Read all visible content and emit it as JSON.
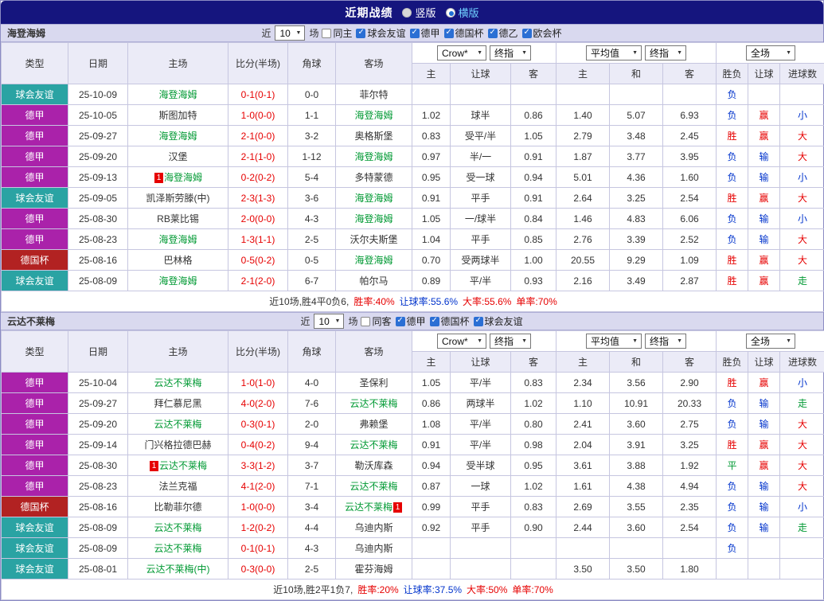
{
  "title_bar": {
    "title": "近期战绩",
    "options": [
      {
        "label": "竖版",
        "selected": false
      },
      {
        "label": "横版",
        "selected": true
      }
    ]
  },
  "table_headers": {
    "left": [
      "类型",
      "日期",
      "主场",
      "比分(半场)",
      "角球",
      "客场"
    ],
    "odds_cols": [
      "主",
      "让球",
      "客"
    ],
    "avg_cols": [
      "主",
      "和",
      "客"
    ],
    "result_cols": [
      "胜负",
      "让球",
      "进球数"
    ],
    "odds_selects": [
      "Crow*",
      "终指"
    ],
    "avg_selects": [
      "平均值",
      "终指"
    ],
    "scope_select": "全场"
  },
  "league_styles": {
    "球会友谊": {
      "bg": "#2aa3a3",
      "fg": "#ffffff"
    },
    "德甲": {
      "bg": "#aa22aa",
      "fg": "#ffffff"
    },
    "德国杯": {
      "bg": "#b22222",
      "fg": "#ffffff"
    }
  },
  "result_colors": {
    "胜": "#e60000",
    "平": "#009933",
    "负": "#0033cc",
    "赢": "#e60000",
    "输": "#0033cc",
    "大": "#e60000",
    "小": "#0033cc",
    "走": "#009933"
  },
  "sections": [
    {
      "team": "海登海姆",
      "filter": {
        "near_label": "近",
        "count": "10",
        "games_label": "场",
        "checkboxes": [
          {
            "label": "同主",
            "checked": false
          },
          {
            "label": "球会友谊",
            "checked": true
          },
          {
            "label": "德甲",
            "checked": true
          },
          {
            "label": "德国杯",
            "checked": true
          },
          {
            "label": "德乙",
            "checked": true
          },
          {
            "label": "欧会杯",
            "checked": true
          }
        ]
      },
      "rows": [
        {
          "lg": "球会友谊",
          "dt": "25-10-09",
          "hm": "海登海姆",
          "hmT": true,
          "aw": "菲尔特",
          "awT": false,
          "sc": "0-1",
          "hf": "(0-1)",
          "cn": "0-0",
          "od": [
            "",
            "",
            ""
          ],
          "av": [
            "",
            "",
            ""
          ],
          "rs": [
            "负",
            "",
            ""
          ]
        },
        {
          "lg": "德甲",
          "dt": "25-10-05",
          "hm": "斯图加特",
          "hmT": false,
          "aw": "海登海姆",
          "awT": true,
          "sc": "1-0",
          "hf": "(0-0)",
          "cn": "1-1",
          "od": [
            "1.02",
            "球半",
            "0.86"
          ],
          "av": [
            "1.40",
            "5.07",
            "6.93"
          ],
          "rs": [
            "负",
            "赢",
            "小"
          ]
        },
        {
          "lg": "德甲",
          "dt": "25-09-27",
          "hm": "海登海姆",
          "hmT": true,
          "aw": "奥格斯堡",
          "awT": false,
          "sc": "2-1",
          "hf": "(0-0)",
          "cn": "3-2",
          "od": [
            "0.83",
            "受平/半",
            "1.05"
          ],
          "av": [
            "2.79",
            "3.48",
            "2.45"
          ],
          "rs": [
            "胜",
            "赢",
            "大"
          ]
        },
        {
          "lg": "德甲",
          "dt": "25-09-20",
          "hm": "汉堡",
          "hmT": false,
          "aw": "海登海姆",
          "awT": true,
          "sc": "2-1",
          "hf": "(1-0)",
          "cn": "1-12",
          "od": [
            "0.97",
            "半/一",
            "0.91"
          ],
          "av": [
            "1.87",
            "3.77",
            "3.95"
          ],
          "rs": [
            "负",
            "输",
            "大"
          ]
        },
        {
          "lg": "德甲",
          "dt": "25-09-13",
          "hm": "海登海姆",
          "hmT": true,
          "hmB": "1",
          "hmBp": "L",
          "aw": "多特蒙德",
          "awT": false,
          "sc": "0-2",
          "hf": "(0-2)",
          "cn": "5-4",
          "od": [
            "0.95",
            "受一球",
            "0.94"
          ],
          "av": [
            "5.01",
            "4.36",
            "1.60"
          ],
          "rs": [
            "负",
            "输",
            "小"
          ]
        },
        {
          "lg": "球会友谊",
          "dt": "25-09-05",
          "hm": "凯泽斯劳滕(中)",
          "hmT": false,
          "aw": "海登海姆",
          "awT": true,
          "sc": "2-3",
          "hf": "(1-3)",
          "cn": "3-6",
          "od": [
            "0.91",
            "平手",
            "0.91"
          ],
          "av": [
            "2.64",
            "3.25",
            "2.54"
          ],
          "rs": [
            "胜",
            "赢",
            "大"
          ]
        },
        {
          "lg": "德甲",
          "dt": "25-08-30",
          "hm": "RB莱比锡",
          "hmT": false,
          "aw": "海登海姆",
          "awT": true,
          "sc": "2-0",
          "hf": "(0-0)",
          "cn": "4-3",
          "od": [
            "1.05",
            "一/球半",
            "0.84"
          ],
          "av": [
            "1.46",
            "4.83",
            "6.06"
          ],
          "rs": [
            "负",
            "输",
            "小"
          ]
        },
        {
          "lg": "德甲",
          "dt": "25-08-23",
          "hm": "海登海姆",
          "hmT": true,
          "aw": "沃尔夫斯堡",
          "awT": false,
          "sc": "1-3",
          "hf": "(1-1)",
          "cn": "2-5",
          "od": [
            "1.04",
            "平手",
            "0.85"
          ],
          "av": [
            "2.76",
            "3.39",
            "2.52"
          ],
          "rs": [
            "负",
            "输",
            "大"
          ]
        },
        {
          "lg": "德国杯",
          "dt": "25-08-16",
          "hm": "巴林格",
          "hmT": false,
          "aw": "海登海姆",
          "awT": true,
          "sc": "0-5",
          "hf": "(0-2)",
          "cn": "0-5",
          "od": [
            "0.70",
            "受两球半",
            "1.00"
          ],
          "av": [
            "20.55",
            "9.29",
            "1.09"
          ],
          "rs": [
            "胜",
            "赢",
            "大"
          ]
        },
        {
          "lg": "球会友谊",
          "dt": "25-08-09",
          "hm": "海登海姆",
          "hmT": true,
          "aw": "帕尔马",
          "awT": false,
          "sc": "2-1",
          "hf": "(2-0)",
          "cn": "6-7",
          "od": [
            "0.89",
            "平/半",
            "0.93"
          ],
          "av": [
            "2.16",
            "3.49",
            "2.87"
          ],
          "rs": [
            "胜",
            "赢",
            "走"
          ]
        }
      ],
      "summary": [
        {
          "text": "近10场,胜4平0负6,",
          "color": "#333333"
        },
        {
          "text": "胜率:40%",
          "color": "#e60000"
        },
        {
          "text": "让球率:55.6%",
          "color": "#0033cc"
        },
        {
          "text": "大率:55.6%",
          "color": "#e60000"
        },
        {
          "text": "单率:70%",
          "color": "#e60000"
        }
      ]
    },
    {
      "team": "云达不莱梅",
      "filter": {
        "near_label": "近",
        "count": "10",
        "games_label": "场",
        "checkboxes": [
          {
            "label": "同客",
            "checked": false
          },
          {
            "label": "德甲",
            "checked": true
          },
          {
            "label": "德国杯",
            "checked": true
          },
          {
            "label": "球会友谊",
            "checked": true
          }
        ]
      },
      "rows": [
        {
          "lg": "德甲",
          "dt": "25-10-04",
          "hm": "云达不莱梅",
          "hmT": true,
          "aw": "圣保利",
          "awT": false,
          "sc": "1-0",
          "hf": "(1-0)",
          "cn": "4-0",
          "od": [
            "1.05",
            "平/半",
            "0.83"
          ],
          "av": [
            "2.34",
            "3.56",
            "2.90"
          ],
          "rs": [
            "胜",
            "赢",
            "小"
          ]
        },
        {
          "lg": "德甲",
          "dt": "25-09-27",
          "hm": "拜仁慕尼黑",
          "hmT": false,
          "aw": "云达不莱梅",
          "awT": true,
          "sc": "4-0",
          "hf": "(2-0)",
          "cn": "7-6",
          "od": [
            "0.86",
            "两球半",
            "1.02"
          ],
          "av": [
            "1.10",
            "10.91",
            "20.33"
          ],
          "rs": [
            "负",
            "输",
            "走"
          ]
        },
        {
          "lg": "德甲",
          "dt": "25-09-20",
          "hm": "云达不莱梅",
          "hmT": true,
          "aw": "弗赖堡",
          "awT": false,
          "sc": "0-3",
          "hf": "(0-1)",
          "cn": "2-0",
          "od": [
            "1.08",
            "平/半",
            "0.80"
          ],
          "av": [
            "2.41",
            "3.60",
            "2.75"
          ],
          "rs": [
            "负",
            "输",
            "大"
          ]
        },
        {
          "lg": "德甲",
          "dt": "25-09-14",
          "hm": "门兴格拉德巴赫",
          "hmT": false,
          "aw": "云达不莱梅",
          "awT": true,
          "sc": "0-4",
          "hf": "(0-2)",
          "cn": "9-4",
          "od": [
            "0.91",
            "平/半",
            "0.98"
          ],
          "av": [
            "2.04",
            "3.91",
            "3.25"
          ],
          "rs": [
            "胜",
            "赢",
            "大"
          ]
        },
        {
          "lg": "德甲",
          "dt": "25-08-30",
          "hm": "云达不莱梅",
          "hmT": true,
          "hmB": "1",
          "hmBp": "L",
          "aw": "勒沃库森",
          "awT": false,
          "sc": "3-3",
          "hf": "(1-2)",
          "cn": "3-7",
          "od": [
            "0.94",
            "受半球",
            "0.95"
          ],
          "av": [
            "3.61",
            "3.88",
            "1.92"
          ],
          "rs": [
            "平",
            "赢",
            "大"
          ]
        },
        {
          "lg": "德甲",
          "dt": "25-08-23",
          "hm": "法兰克福",
          "hmT": false,
          "aw": "云达不莱梅",
          "awT": true,
          "sc": "4-1",
          "hf": "(2-0)",
          "cn": "7-1",
          "od": [
            "0.87",
            "一球",
            "1.02"
          ],
          "av": [
            "1.61",
            "4.38",
            "4.94"
          ],
          "rs": [
            "负",
            "输",
            "大"
          ]
        },
        {
          "lg": "德国杯",
          "dt": "25-08-16",
          "hm": "比勒菲尔德",
          "hmT": false,
          "aw": "云达不莱梅",
          "awT": true,
          "awB": "1",
          "awBp": "R",
          "sc": "1-0",
          "hf": "(0-0)",
          "cn": "3-4",
          "od": [
            "0.99",
            "平手",
            "0.83"
          ],
          "av": [
            "2.69",
            "3.55",
            "2.35"
          ],
          "rs": [
            "负",
            "输",
            "小"
          ]
        },
        {
          "lg": "球会友谊",
          "dt": "25-08-09",
          "hm": "云达不莱梅",
          "hmT": true,
          "aw": "乌迪内斯",
          "awT": false,
          "sc": "1-2",
          "hf": "(0-2)",
          "cn": "4-4",
          "od": [
            "0.92",
            "平手",
            "0.90"
          ],
          "av": [
            "2.44",
            "3.60",
            "2.54"
          ],
          "rs": [
            "负",
            "输",
            "走"
          ]
        },
        {
          "lg": "球会友谊",
          "dt": "25-08-09",
          "hm": "云达不莱梅",
          "hmT": true,
          "aw": "乌迪内斯",
          "awT": false,
          "sc": "0-1",
          "hf": "(0-1)",
          "cn": "4-3",
          "od": [
            "",
            "",
            ""
          ],
          "av": [
            "",
            "",
            ""
          ],
          "rs": [
            "负",
            "",
            ""
          ]
        },
        {
          "lg": "球会友谊",
          "dt": "25-08-01",
          "hm": "云达不莱梅(中)",
          "hmT": true,
          "aw": "霍芬海姆",
          "awT": false,
          "sc": "0-3",
          "hf": "(0-0)",
          "cn": "2-5",
          "od": [
            "",
            "",
            ""
          ],
          "av": [
            "3.50",
            "3.50",
            "1.80"
          ],
          "rs": [
            "",
            "",
            ""
          ]
        }
      ],
      "summary": [
        {
          "text": "近10场,胜2平1负7,",
          "color": "#333333"
        },
        {
          "text": "胜率:20%",
          "color": "#e60000"
        },
        {
          "text": "让球率:37.5%",
          "color": "#0033cc"
        },
        {
          "text": "大率:50%",
          "color": "#e60000"
        },
        {
          "text": "单率:70%",
          "color": "#e60000"
        }
      ]
    }
  ]
}
